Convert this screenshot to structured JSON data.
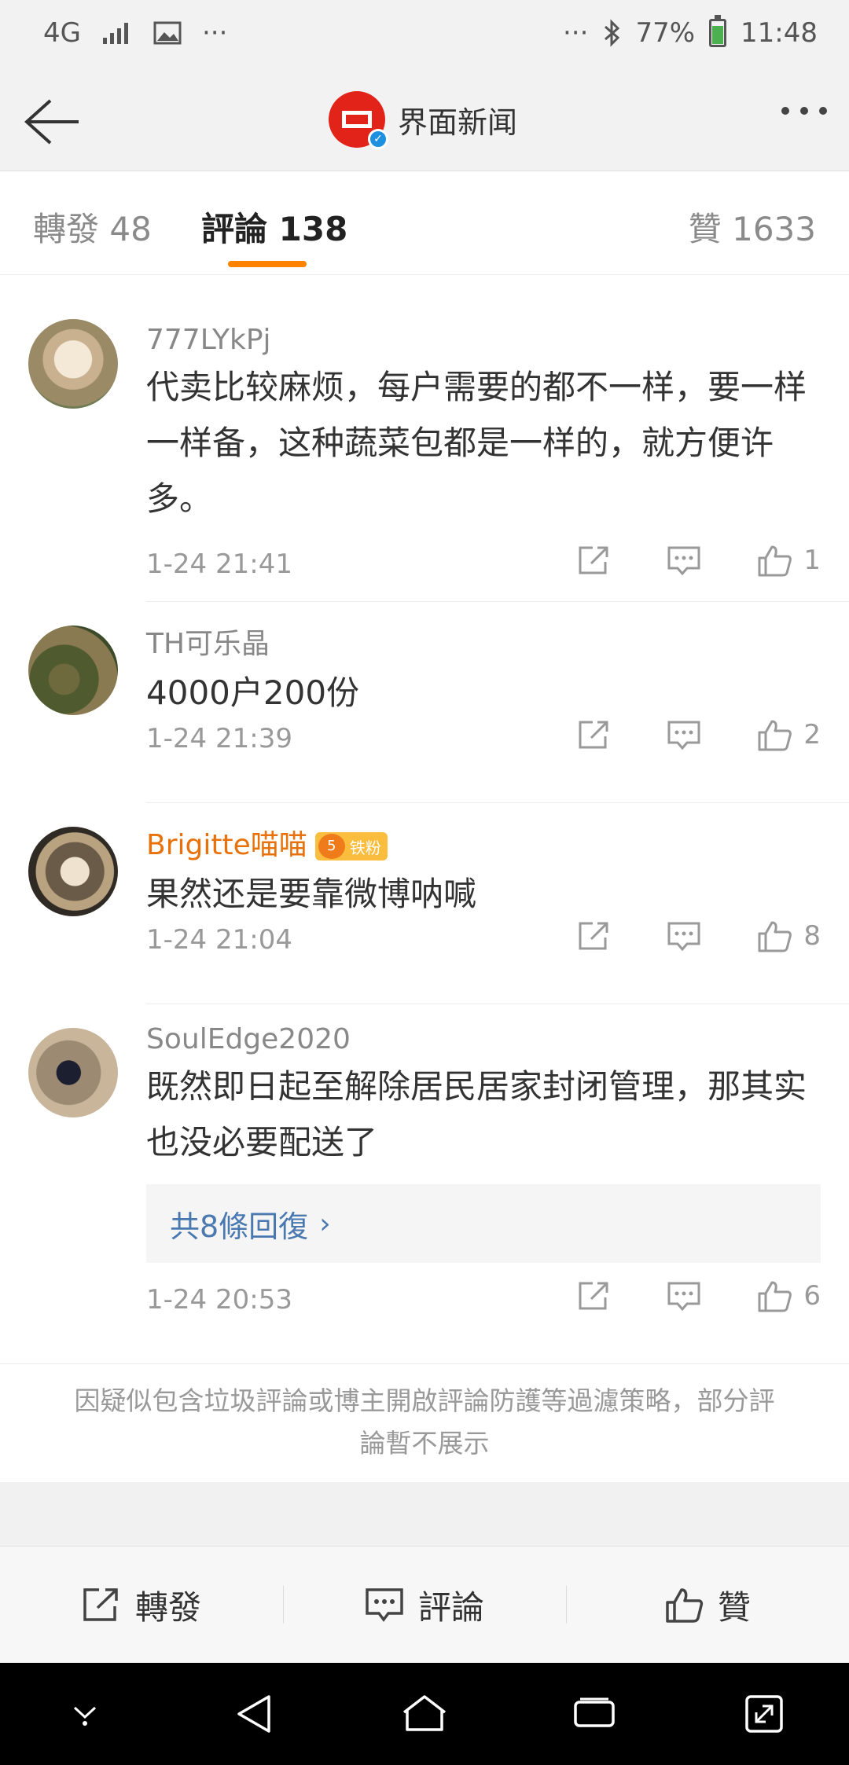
{
  "status_bar": {
    "network": "4G",
    "more_left": "···",
    "more_right": "···",
    "battery": "77%",
    "time": "11:48",
    "battery_level": 0.77
  },
  "header": {
    "title": "界面新闻"
  },
  "tabs": [
    {
      "label": "轉發 48"
    },
    {
      "label": "評論 138"
    },
    {
      "label": "贊 1633"
    }
  ],
  "comments": [
    {
      "user": "777LYkPj",
      "text": "代卖比较麻烦，每户需要的都不一样，要一样一样备，这种蔬菜包都是一样的，就方便许多。",
      "time": "1-24 21:41",
      "likes": "1"
    },
    {
      "user": "TH可乐晶",
      "text": "4000户200份",
      "time": "1-24 21:39",
      "likes": "2"
    },
    {
      "user": "Brigitte喵喵",
      "badge_level": "5",
      "badge_label": "铁粉",
      "text": "果然还是要靠微博呐喊",
      "time": "1-24 21:04",
      "likes": "8"
    },
    {
      "user": "SoulEdge2020",
      "text": "既然即日起至解除居民居家封闭管理，那其实也没必要配送了",
      "replies": "共8條回復",
      "time": "1-24 20:53",
      "likes": "6"
    }
  ],
  "notice": "因疑似包含垃圾評論或博主開啟評論防護等過濾策略，部分評論暫不展示",
  "bottom_bar": {
    "forward": "轉發",
    "comment": "評論",
    "like": "贊"
  },
  "colors": {
    "accent": "#ff8200",
    "fan_name": "#e8710a",
    "link": "#4a78b0"
  }
}
